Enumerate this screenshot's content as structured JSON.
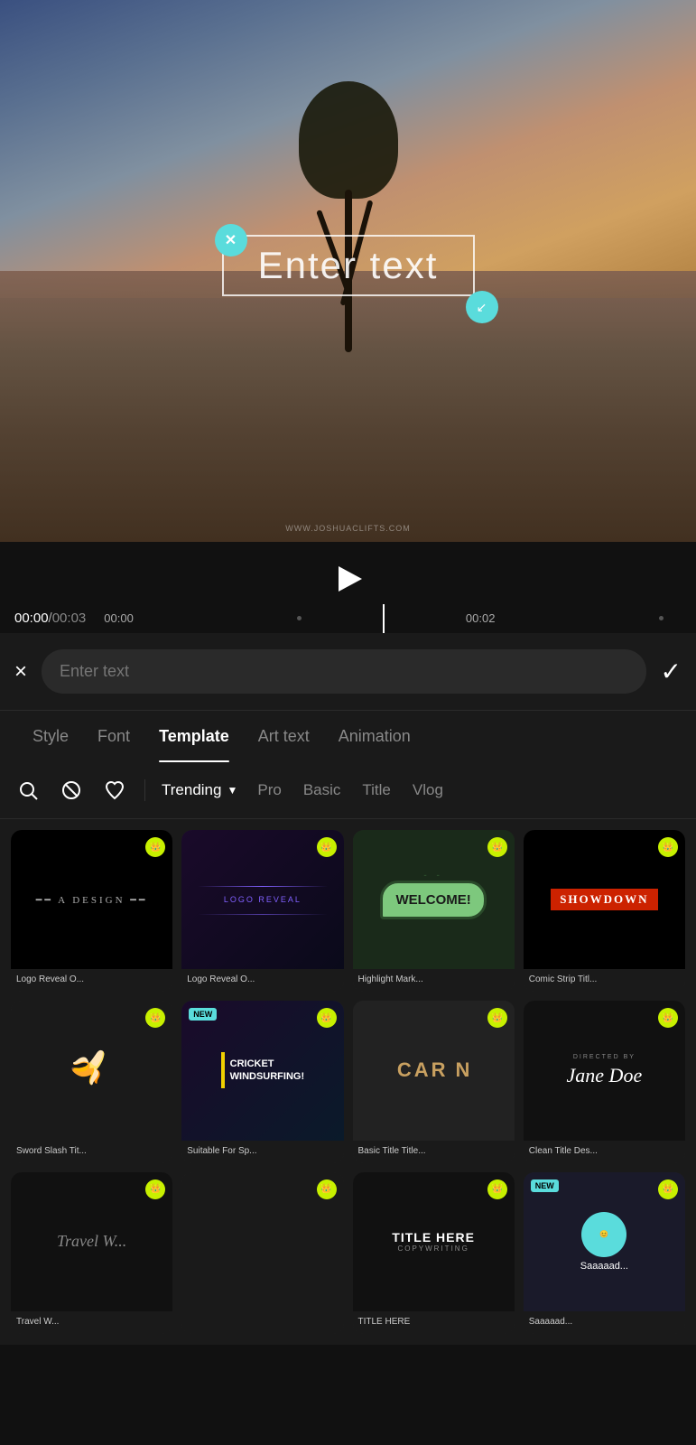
{
  "video": {
    "watermark": "WWW.JOSHUACLIFTS.COM",
    "text_overlay": "Enter text",
    "duration": "00:03",
    "current_time": "00:00",
    "marker1": "00:00",
    "marker2": "00:02"
  },
  "text_input": {
    "placeholder": "Enter text",
    "close_label": "×",
    "check_label": "✓"
  },
  "tabs": [
    {
      "label": "Style",
      "active": false
    },
    {
      "label": "Font",
      "active": false
    },
    {
      "label": "Template",
      "active": true
    },
    {
      "label": "Art text",
      "active": false
    },
    {
      "label": "Animation",
      "active": false
    }
  ],
  "filters": {
    "dropdown_label": "Trending",
    "options": [
      "Pro",
      "Basic",
      "Title",
      "Vlog"
    ]
  },
  "templates": [
    {
      "id": 1,
      "label": "Logo Reveal O...",
      "thumb_type": "logo-reveal-1",
      "pro": true,
      "new": false
    },
    {
      "id": 2,
      "label": "Logo Reveal O...",
      "thumb_type": "logo-reveal-2",
      "pro": true,
      "new": false
    },
    {
      "id": 3,
      "label": "Highlight Mark...",
      "thumb_type": "highlight",
      "pro": true,
      "new": false
    },
    {
      "id": 4,
      "label": "Comic Strip Titl...",
      "thumb_type": "comic",
      "pro": true,
      "new": false
    },
    {
      "id": 5,
      "label": "Sword Slash Tit...",
      "thumb_type": "sword",
      "pro": true,
      "new": false
    },
    {
      "id": 6,
      "label": "Suitable For Sp...",
      "thumb_type": "cricket",
      "pro": true,
      "new": true
    },
    {
      "id": 7,
      "label": "Basic Title Title...",
      "thumb_type": "car",
      "pro": true,
      "new": false
    },
    {
      "id": 8,
      "label": "Clean Title Des...",
      "thumb_type": "jane",
      "pro": true,
      "new": false
    },
    {
      "id": 9,
      "label": "Travel W...",
      "thumb_type": "travel",
      "pro": true,
      "new": false
    },
    {
      "id": 10,
      "label": "",
      "thumb_type": "empty",
      "pro": true,
      "new": false
    },
    {
      "id": 11,
      "label": "TITLE HERE",
      "thumb_type": "title-here",
      "pro": true,
      "new": false
    },
    {
      "id": 12,
      "label": "Saaaaad...",
      "thumb_type": "saaaaa",
      "pro": true,
      "new": true
    }
  ]
}
